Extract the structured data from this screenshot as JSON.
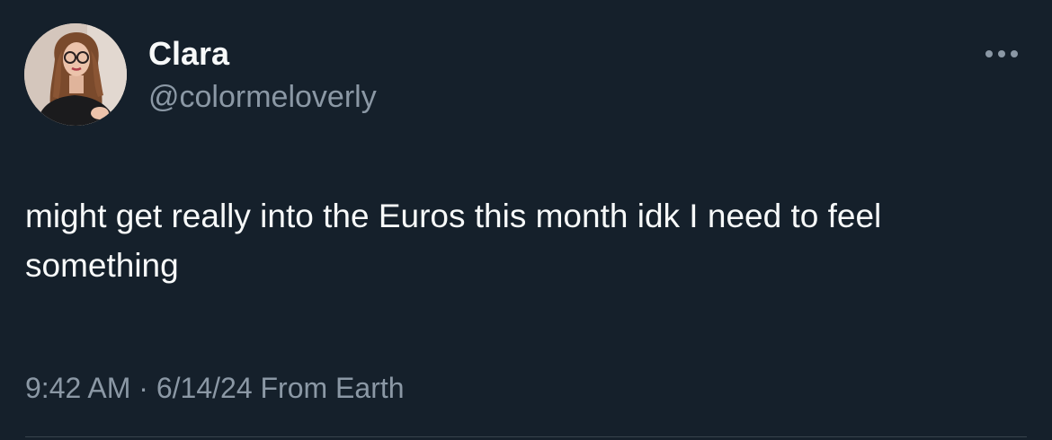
{
  "author": {
    "display_name": "Clara",
    "handle": "@colormeloverly"
  },
  "tweet": {
    "text": "might get really into the Euros this month idk I need to feel something",
    "time": "9:42 AM",
    "separator": "·",
    "date": "6/14/24",
    "location": "From Earth"
  },
  "icons": {
    "more": "more-horizontal-icon"
  },
  "colors": {
    "background": "#15202b",
    "primary_text": "#f7f9f9",
    "secondary_text": "#8b98a5"
  }
}
